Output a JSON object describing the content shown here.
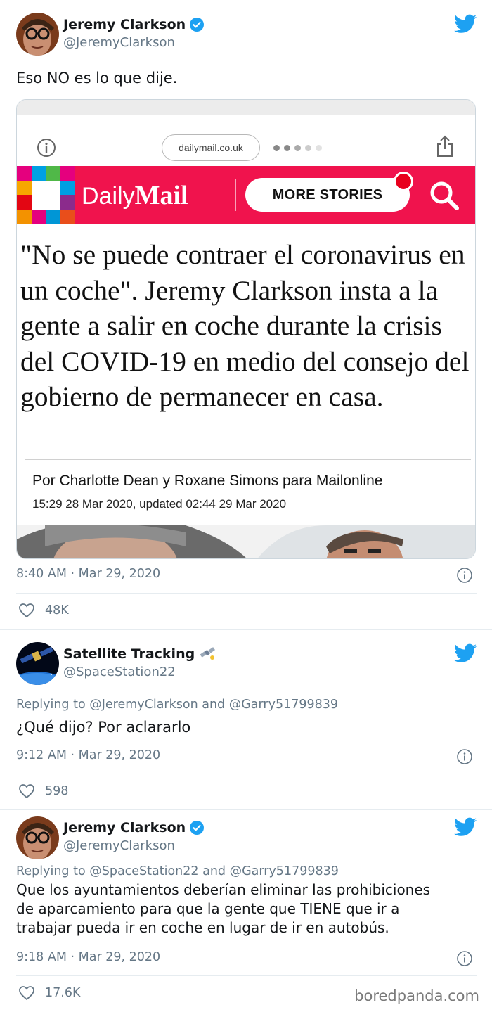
{
  "tweets": [
    {
      "name": "Jeremy Clarkson",
      "handle": "@JeremyClarkson",
      "verified": true,
      "text": "Eso NO es lo que dije.",
      "time": "8:40 AM · Mar 29, 2020",
      "likes": "48K",
      "embed": {
        "url": "dailymail.co.uk",
        "brand_light": "Daily",
        "brand_bold": "Mail",
        "more_stories": "MORE STORIES",
        "headline": "\"No se puede contraer el coronavirus en un coche\". Jeremy Clarkson insta a la gente a salir en coche durante la crisis del COVID-19 en medio del consejo del gobierno de permanecer en casa.",
        "byline": "Por Charlotte Dean y Roxane Simons para Mailonline",
        "dateline": "15:29 28 Mar 2020, updated 02:44 29 Mar 2020"
      }
    },
    {
      "name": "Satellite Tracking",
      "handle": "@SpaceStation22",
      "verified": false,
      "replying": "Replying to @JeremyClarkson and @Garry51799839",
      "text": "¿Qué dijo? Por aclararlo",
      "time": "9:12 AM · Mar 29, 2020",
      "likes": "598"
    },
    {
      "name": "Jeremy Clarkson",
      "handle": "@JeremyClarkson",
      "verified": true,
      "replying": "Replying to @SpaceStation22 and @Garry51799839",
      "text_lines": [
        "Que los ayuntamientos deberían eliminar las prohibiciones",
        "de aparcamiento para que la gente que TIENE que ir a",
        "trabajar pueda ir en coche en lugar de ir en autobús."
      ],
      "time": "9:18 AM · Mar 29, 2020",
      "likes": "17.6K"
    }
  ],
  "watermark": "boredpanda.com",
  "colors": {
    "twitter_blue": "#1da1f2",
    "daily_mail_red": "#f0134d",
    "muted_text": "#657786"
  }
}
